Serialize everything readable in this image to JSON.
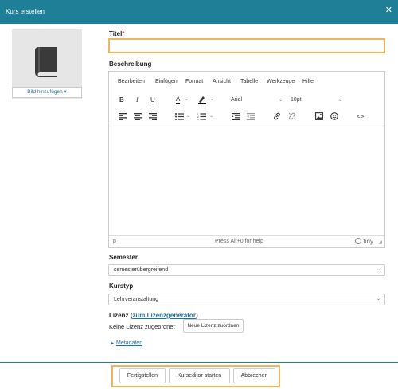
{
  "window": {
    "title": "Kurs erstellen",
    "close_symbol": "✕"
  },
  "image": {
    "button_label": "Bild hinzufügen",
    "caret": "▾",
    "icon": "book-icon"
  },
  "fields": {
    "title_label": "Titel",
    "required_mark": "*",
    "title_value": "",
    "description_label": "Beschreibung",
    "semester_label": "Semester",
    "semester_value": "semesterübergreifend",
    "coursetype_label": "Kurstyp",
    "coursetype_value": "Lehrveranstaltung"
  },
  "editor": {
    "menu": [
      "Bearbeiten",
      "Einfügen",
      "Format",
      "Ansicht",
      "Tabelle",
      "Werkzeuge",
      "Hilfe"
    ],
    "font_family": "Arial",
    "font_size": "10pt",
    "status_path": "p",
    "status_help": "Press Alt+0 for help",
    "brand": "tiny",
    "toolbar": {
      "bold": "B",
      "italic": "I",
      "underline": "U",
      "code": "<>",
      "text_color": "A"
    }
  },
  "license": {
    "label": "Lizenz",
    "link_open": "(",
    "link_text": "zum Lizenzgenerator",
    "link_close": ")",
    "value_text": "Keine Lizenz zugeordnet",
    "assign_button": "Neue Lizenz zuordnen"
  },
  "metadata": {
    "label": "Metadaten",
    "caret": "▸"
  },
  "footer": {
    "finish_button": "Fertigstellen",
    "editor_button": "Kurseditor starten",
    "cancel_button": "Abbrechen"
  },
  "colors": {
    "header": "#1f7f96",
    "highlight": "#f0b45a",
    "link": "#1f6fa0"
  }
}
